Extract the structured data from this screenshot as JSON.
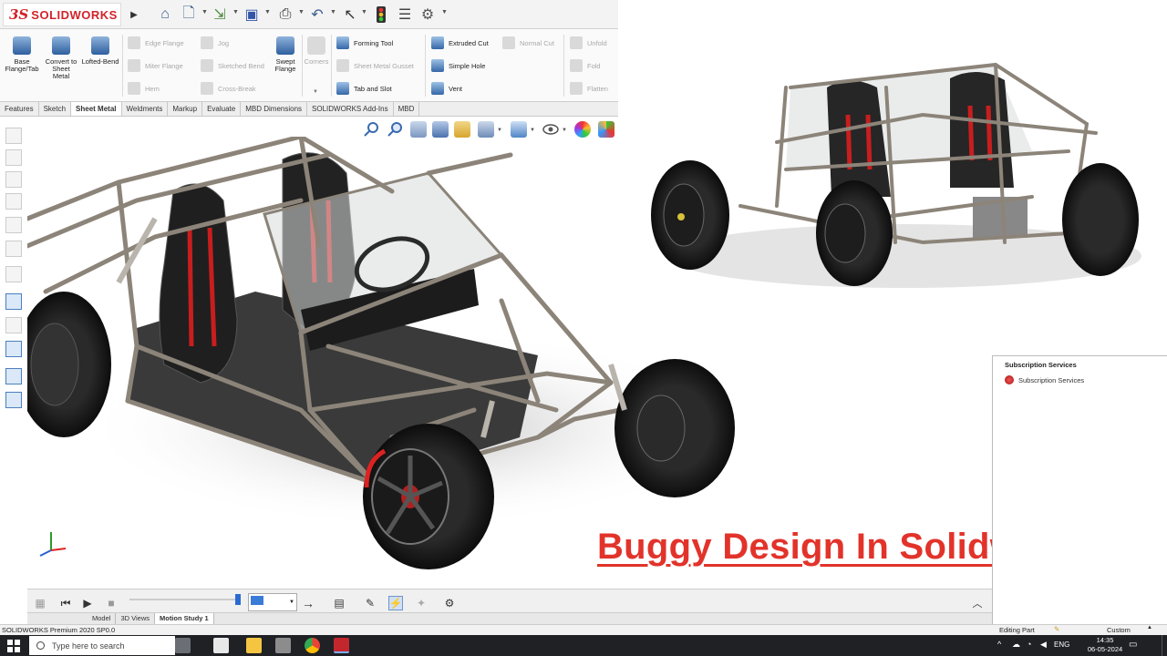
{
  "app": {
    "logo_ds": "3S",
    "logo_text": "SOLIDWORKS"
  },
  "quick_access": [
    "home-icon",
    "new-document-icon",
    "open-icon",
    "save-icon",
    "print-icon",
    "undo-icon",
    "select-icon",
    "rebuild-icon",
    "file-properties-icon",
    "options-icon"
  ],
  "ribbon": {
    "base_flange": "Base Flange/Tab",
    "convert": "Convert to Sheet Metal",
    "lofted_bend": "Lofted-Bend",
    "edge_flange": "Edge Flange",
    "miter_flange": "Miter Flange",
    "hem": "Hem",
    "jog": "Jog",
    "sketched_bend": "Sketched Bend",
    "cross_break": "Cross-Break",
    "swept_flange": "Swept Flange",
    "corners": "Corners",
    "forming_tool": "Forming Tool",
    "sheet_metal_gusset": "Sheet Metal Gusset",
    "tab_and_slot": "Tab and Slot",
    "extruded_cut": "Extruded Cut",
    "simple_hole": "Simple Hole",
    "vent": "Vent",
    "normal_cut": "Normal Cut",
    "unfold": "Unfold",
    "fold": "Fold",
    "flatten": "Flatten"
  },
  "tabs": [
    "Features",
    "Sketch",
    "Sheet Metal",
    "Weldments",
    "Markup",
    "Evaluate",
    "MBD Dimensions",
    "SOLIDWORKS Add-Ins",
    "MBD"
  ],
  "active_tab": "Sheet Metal",
  "overlay_title": "Buggy Design In Solidworks",
  "task_pane": {
    "heading": "Subscription Services",
    "item": "Subscription Services"
  },
  "motion": {
    "tabs": [
      "Model",
      "3D Views",
      "Motion Study 1"
    ],
    "active_tab": "Motion Study 1",
    "slider_value": 0.97
  },
  "status": {
    "product": "SOLIDWORKS Premium 2020 SP0.0",
    "mode": "Editing Part",
    "units": "Custom"
  },
  "taskbar": {
    "search_placeholder": "Type here to search",
    "lang": "ENG",
    "time": "14:35",
    "date": "06-05-2024"
  },
  "colors": {
    "accent_red": "#e2332b",
    "brand_red": "#d2232a",
    "frame": "#8c8479",
    "seat_belt": "#c81e1e"
  }
}
